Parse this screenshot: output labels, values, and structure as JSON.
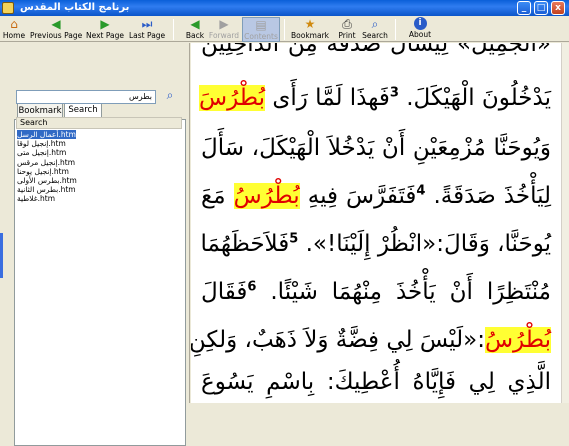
{
  "window": {
    "title": "برنامج الكتاب المقدس",
    "min": "_",
    "max": "□",
    "close": "x"
  },
  "toolbar": {
    "home": "Home",
    "previous_page": "Previous Page",
    "next_page": "Next Page",
    "last_page": "Last Page",
    "back": "Back",
    "forward": "Forward",
    "contents": "Contents",
    "bookmark": "Bookmark",
    "print": "Print",
    "search": "Search",
    "about": "About"
  },
  "icons": {
    "home": "⌂",
    "prev": "◀",
    "next": "▶",
    "last": "⏭",
    "back": "◀",
    "forward": "▶",
    "contents": "▤",
    "bookmark": "★",
    "print": "⎙",
    "search": "⌕",
    "about": "i"
  },
  "colors": {
    "highlight": "#ffff33",
    "highlight_text": "#e00000",
    "selection": "#316ac5",
    "title_bar": "#0a5fd8"
  },
  "sidebar": {
    "tabs": [
      "Bookmark",
      "Search"
    ],
    "active_tab": "Search",
    "search_value": "بطرس",
    "search_header": "Search",
    "results": [
      "أعمال الرسل.htm",
      "إنجيل لوقا.htm",
      "إنجيل متى.htm",
      "إنجيل مرقس.htm",
      "إنجيل يوحنا.htm",
      "بطرس الأولى.htm",
      "بطرس الثانية.htm",
      "غلاطية.htm"
    ]
  },
  "content": {
    "top_cut": "«الْجَمِيلُ» لِيَسْأَلَ صَدَقَةً مِنَ الدَّاخِلِينَ",
    "l1": "يَدْخُلُونَ الْهَيْكَلَ.",
    "v3": "3",
    "l1b": "فَهذَا لَمَّا رَأَى",
    "peter": "بُطْرُسَ",
    "l2": "وَيُوحَنَّا مُزْمِعَيْنِ أَنْ يَدْخُلاَ الْهَيْكَلَ، سَأَلَ",
    "l3": "لِيَأْخُذَ صَدَقَةً.",
    "v4": "4",
    "l3b": "فَتَفَرَّسَ فِيهِ",
    "peter2": "بُطْرُسُ",
    "l3c": "مَعَ",
    "l4": "يُوحَنَّا، وَقَالَ:«انْظُرْ إِلَيْنَا!».",
    "v5": "5",
    "l4b": "فَلاَحَظَهُمَا",
    "l5": "مُنْتَظِرًا أَنْ يَأْخُذَ مِنْهُمَا شَيْئًا.",
    "v6": "6",
    "l5b": "فَقَالَ",
    "peter3": "بُطْرُسُ",
    "l6": ":«لَيْسَ لِي فِضَّةٌ وَلاَ ذَهَبٌ، وَلكِنِ",
    "l7": "الَّذِي لِي فَإِيَّاهُ أُعْطِيكَ: بِاسْمِ يَسُوعَ"
  }
}
